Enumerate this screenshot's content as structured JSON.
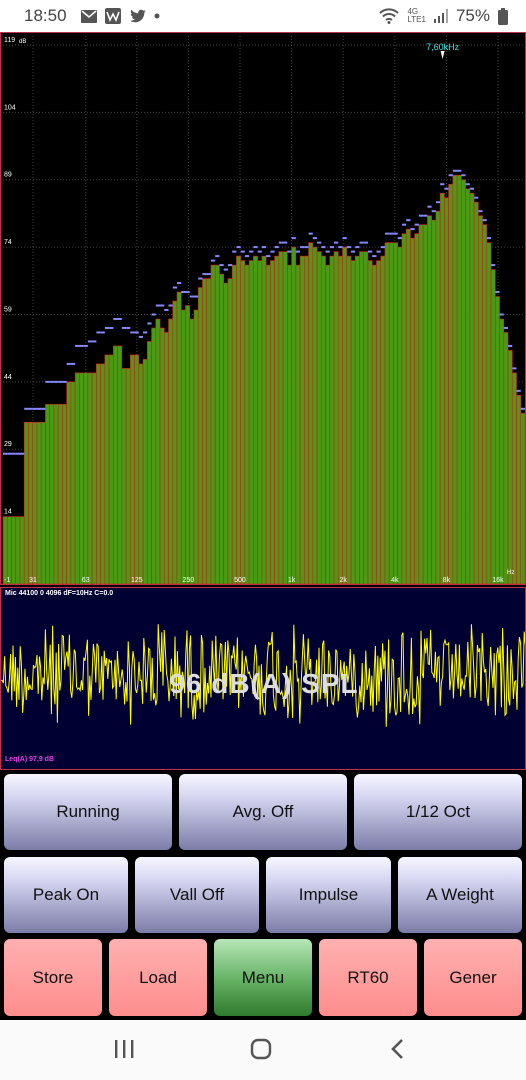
{
  "status_bar": {
    "time": "18:50",
    "battery": "75%",
    "network": "4G",
    "network_sub": "LTE1",
    "icons": [
      "mail-icon",
      "w-app-icon",
      "twitter-icon",
      "dot-icon",
      "wifi-icon",
      "signal-icon",
      "battery-icon"
    ]
  },
  "chart_data": {
    "type": "bar",
    "title": "",
    "ylabel": "dB",
    "xlabel": "Hz",
    "ylim": [
      -1,
      121
    ],
    "yticks": [
      "119",
      "104",
      "89",
      "74",
      "59",
      "44",
      "29",
      "14"
    ],
    "ytick_values": [
      119,
      104,
      89,
      74,
      59,
      44,
      29,
      14
    ],
    "xticks": [
      "31",
      "63",
      "125",
      "250",
      "500",
      "1k",
      "2k",
      "4k",
      "8k",
      "16k"
    ],
    "xtick_values": [
      31,
      63,
      125,
      250,
      500,
      1000,
      2000,
      4000,
      8000,
      16000
    ],
    "x_corner_label": "-1",
    "scale": "log-frequency 1/12 octave",
    "cursor_label": "7,60kHz",
    "cursor_freq": 7600,
    "grid": true,
    "series": [
      {
        "values": [
          14,
          14,
          14,
          14,
          14,
          35,
          35,
          35,
          35,
          35,
          39,
          39,
          39,
          39,
          39,
          44,
          44,
          46,
          46,
          46,
          46,
          46,
          48,
          48,
          50,
          50,
          52,
          52,
          47,
          47,
          50,
          50,
          48,
          49,
          53,
          56,
          58,
          56,
          55,
          58,
          62,
          64,
          60,
          61,
          58,
          60,
          65,
          67,
          67,
          70,
          70,
          68,
          66,
          67,
          70,
          72,
          71,
          70,
          71,
          72,
          71,
          72,
          70,
          71,
          72,
          73,
          73,
          70,
          74,
          70,
          72,
          72,
          75,
          74,
          73,
          72,
          70,
          72,
          73,
          72,
          74,
          72,
          71,
          72,
          73,
          73,
          71,
          70,
          71,
          72,
          75,
          75,
          75,
          74,
          77,
          78,
          76,
          77,
          79,
          79,
          81,
          80,
          82,
          86,
          85,
          88,
          90,
          90,
          89,
          87,
          86,
          84,
          81,
          79,
          75,
          69,
          63,
          58,
          55,
          51,
          46,
          41,
          37
        ]
      },
      {
        "values": [
          28,
          28,
          28,
          28,
          28,
          38,
          38,
          38,
          38,
          38,
          44,
          44,
          44,
          44,
          44,
          48,
          48,
          52,
          52,
          52,
          53,
          53,
          55,
          55,
          56,
          56,
          58,
          58,
          56,
          56,
          55,
          55,
          54,
          55,
          57,
          59,
          61,
          61,
          60,
          61,
          65,
          66,
          64,
          64,
          63,
          63,
          67,
          68,
          68,
          71,
          72,
          70,
          69,
          70,
          73,
          74,
          73,
          72,
          73,
          74,
          73,
          74,
          72,
          73,
          74,
          75,
          75,
          73,
          76,
          73,
          74,
          74,
          77,
          76,
          75,
          74,
          73,
          74,
          75,
          74,
          76,
          74,
          73,
          74,
          75,
          75,
          73,
          72,
          73,
          74,
          77,
          77,
          77,
          76,
          79,
          80,
          78,
          79,
          81,
          81,
          83,
          82,
          84,
          88,
          87,
          90,
          91,
          91,
          90,
          88,
          87,
          85,
          82,
          80,
          76,
          70,
          64,
          59,
          56,
          52,
          47,
          42,
          38
        ]
      }
    ]
  },
  "wave_info": "Mic 44100 0 4096 dF=10Hz C=0.0",
  "spl_text": "96 dB(A) SPL",
  "leq_text": "Leq(A) 97,9 dB",
  "buttons": {
    "row1": [
      "Running",
      "Avg. Off",
      "1/12 Oct"
    ],
    "row2": [
      "Peak On",
      "Vall Off",
      "Impulse",
      "A Weight"
    ],
    "row3": [
      "Store",
      "Load",
      "Menu",
      "RT60",
      "Gener"
    ]
  },
  "colors": {
    "bar_fill": "#4a9a14",
    "bar_outline": "#cc2222",
    "peak": "#8888ff",
    "wave": "#ffff00",
    "wave_bg": "#000033"
  }
}
